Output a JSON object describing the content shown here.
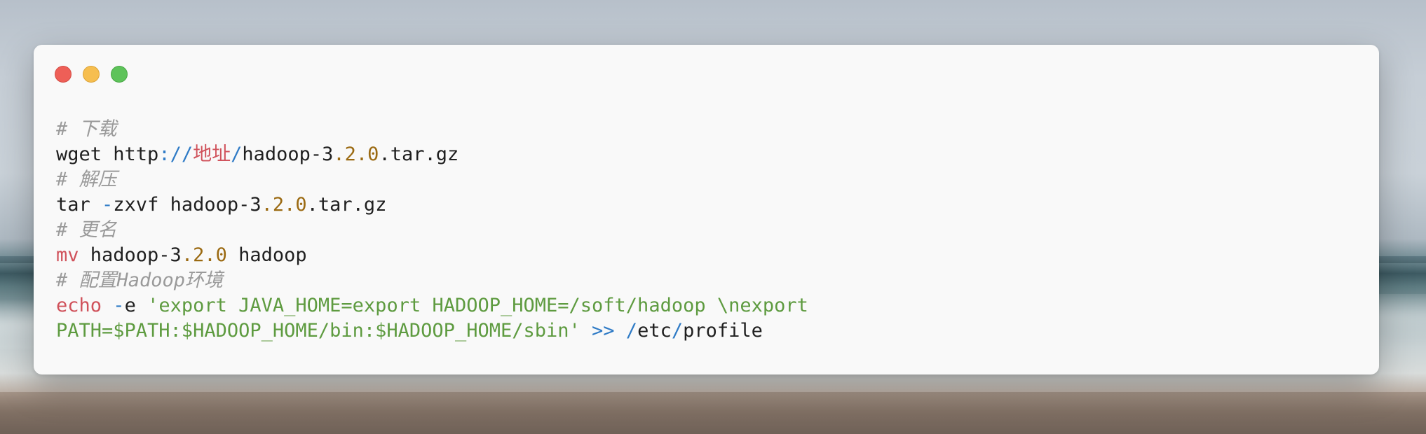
{
  "window": {
    "controls": {
      "close_color": "#ee5f57",
      "minimize_color": "#f6be4f",
      "maximize_color": "#5ec35a"
    }
  },
  "code": {
    "language": "bash",
    "lines": [
      {
        "comment": "# 下载"
      },
      {
        "cmd": "wget http",
        "punct1": "://",
        "addr": "地址",
        "punct2": "/",
        "pre": "hadoop-3",
        "ver": ".2.0",
        "post": ".tar.gz"
      },
      {
        "comment": "# 解压"
      },
      {
        "cmd": "tar ",
        "flag": "-",
        "rest": "zxvf hadoop-3",
        "ver": ".2.0",
        "post": ".tar.gz"
      },
      {
        "comment": "# 更名"
      },
      {
        "kw": "mv",
        "pre": " hadoop-3",
        "ver": ".2.0",
        "post": " hadoop"
      },
      {
        "comment": "# 配置Hadoop环境"
      },
      {
        "kw": "echo",
        "sp": " ",
        "flag": "-",
        "rest": "e ",
        "str": "'export JAVA_HOME=export HADOOP_HOME=/soft/hadoop \\nexport"
      },
      {
        "str": "PATH=$PATH:$HADOOP_HOME/bin:$HADOOP_HOME/sbin'",
        "sp": " ",
        "op": ">>",
        "sp2": " ",
        "slash1": "/",
        "etc": "etc",
        "slash2": "/",
        "profile": "profile"
      }
    ]
  }
}
